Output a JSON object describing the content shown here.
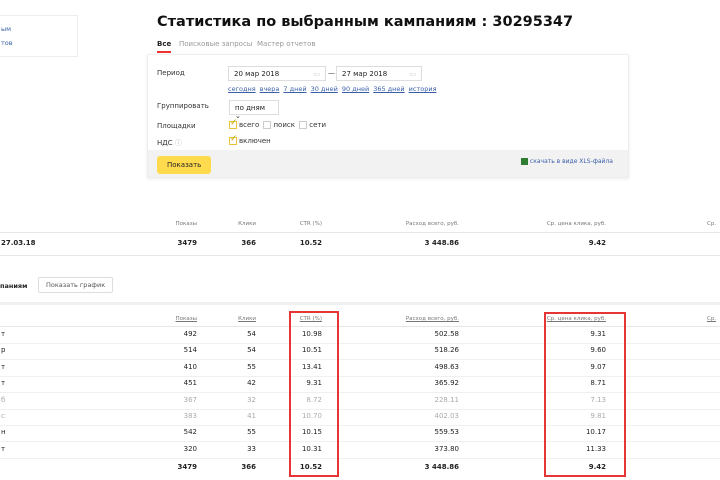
{
  "sidebar": {
    "items": [
      "ым",
      "тов"
    ]
  },
  "header": {
    "title": "Статистика по выбранным кампаниям : 30295347"
  },
  "tabs": [
    "Все",
    "Поисковые запросы",
    "Мастер отчетов"
  ],
  "filters": {
    "period_label": "Период",
    "date_from": "20 мар 2018",
    "date_to": "27 мар 2018",
    "dash": "—",
    "quick_links": [
      "сегодня",
      "вчера",
      "7 дней",
      "30 дней",
      "90 дней",
      "365 дней",
      "история"
    ],
    "group_label": "Группировать",
    "group_value": "по дням",
    "platforms_label": "Площадки",
    "platforms": [
      {
        "label": "всего",
        "checked": true
      },
      {
        "label": "поиск",
        "checked": false
      },
      {
        "label": "сети",
        "checked": false
      }
    ],
    "vat_label": "НДС",
    "vat_option": "включен",
    "show_button": "Показать",
    "download_link": "скачать в виде XLS-файла"
  },
  "summary": {
    "headers": [
      "Показы",
      "Клики",
      "CTR (%)",
      "Расход всего, руб.",
      "Ср. цена клика, руб.",
      "Ср."
    ],
    "row": {
      "label": "27.03.18",
      "values": [
        "3479",
        "366",
        "10.52",
        "3 448.86",
        "9.42"
      ]
    }
  },
  "section": {
    "label": "паниям",
    "chart_button": "Показать график"
  },
  "table": {
    "headers": [
      "Показы",
      "Клики",
      "CTR (%)",
      "Расход всего, руб.",
      "Ср. цена клика, руб.",
      "Ср."
    ],
    "rows": [
      {
        "day": "т",
        "v": [
          "492",
          "54",
          "10.98",
          "502.58",
          "9.31"
        ],
        "dim": false
      },
      {
        "day": "р",
        "v": [
          "514",
          "54",
          "10.51",
          "518.26",
          "9.60"
        ],
        "dim": false
      },
      {
        "day": "т",
        "v": [
          "410",
          "55",
          "13.41",
          "498.63",
          "9.07"
        ],
        "dim": false
      },
      {
        "day": "т",
        "v": [
          "451",
          "42",
          "9.31",
          "365.92",
          "8.71"
        ],
        "dim": false
      },
      {
        "day": "б",
        "v": [
          "367",
          "32",
          "8.72",
          "228.11",
          "7.13"
        ],
        "dim": true
      },
      {
        "day": "с",
        "v": [
          "383",
          "41",
          "10.70",
          "402.03",
          "9.81"
        ],
        "dim": true
      },
      {
        "day": "н",
        "v": [
          "542",
          "55",
          "10.15",
          "559.53",
          "10.17"
        ],
        "dim": false
      },
      {
        "day": "т",
        "v": [
          "320",
          "33",
          "10.31",
          "373.80",
          "11.33"
        ],
        "dim": false
      }
    ],
    "total": [
      "3479",
      "366",
      "10.52",
      "3 448.86",
      "9.42"
    ]
  }
}
